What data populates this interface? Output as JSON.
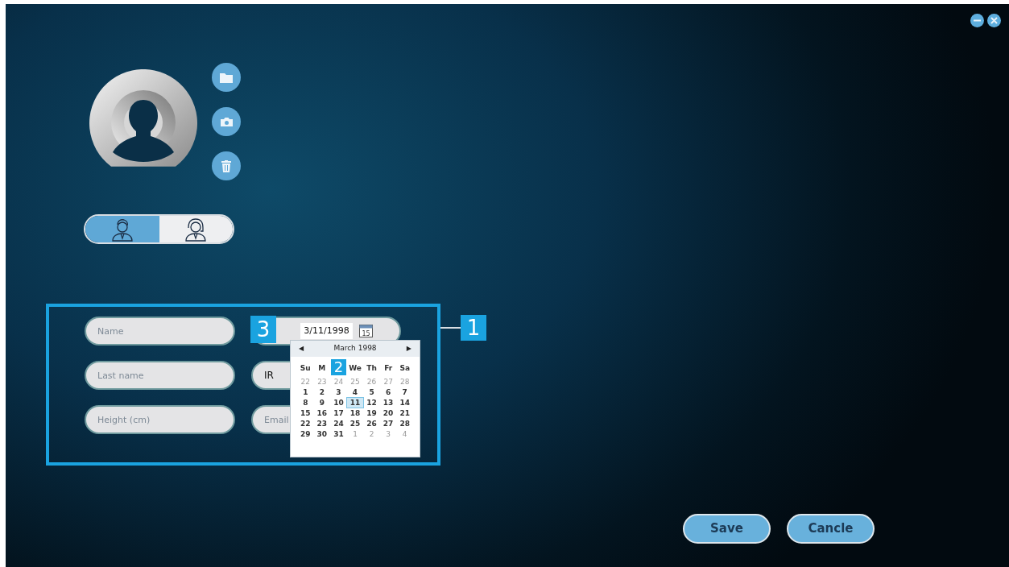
{
  "window": {
    "controls": [
      {
        "kind": "minimize"
      },
      {
        "kind": "close"
      }
    ]
  },
  "photo": {
    "actions": [
      {
        "kind": "folder"
      },
      {
        "kind": "camera"
      },
      {
        "kind": "delete"
      }
    ]
  },
  "gender": [
    {
      "kind": "male",
      "selected": true
    },
    {
      "kind": "female",
      "selected": false
    }
  ],
  "form": {
    "annotation": "1",
    "left_fields": [
      {
        "placeholder": "Name"
      },
      {
        "placeholder": "Last name"
      },
      {
        "placeholder": "Height (cm)"
      }
    ],
    "date_field": {
      "value": "3/11/1998",
      "icon_text": "15",
      "annotation": "3"
    },
    "region_field": {
      "value": "IR"
    },
    "email_field": {
      "placeholder": "Email"
    }
  },
  "calendar": {
    "title": "March 1998",
    "annotation": "2",
    "prev": "◀",
    "next": "▶",
    "weekdays": [
      "Su",
      "M",
      "We",
      "Th",
      "Fr",
      "Sa"
    ],
    "weeks": [
      [
        {
          "day": "22",
          "muted": true,
          "selected": false
        },
        {
          "day": "23",
          "muted": true,
          "selected": false
        },
        {
          "day": "24",
          "muted": true,
          "selected": false
        },
        {
          "day": "25",
          "muted": true,
          "selected": false
        },
        {
          "day": "26",
          "muted": true,
          "selected": false
        },
        {
          "day": "27",
          "muted": true,
          "selected": false
        },
        {
          "day": "28",
          "muted": true,
          "selected": false
        }
      ],
      [
        {
          "day": "1",
          "muted": false,
          "selected": false
        },
        {
          "day": "2",
          "muted": false,
          "selected": false
        },
        {
          "day": "3",
          "muted": false,
          "selected": false
        },
        {
          "day": "4",
          "muted": false,
          "selected": false
        },
        {
          "day": "5",
          "muted": false,
          "selected": false
        },
        {
          "day": "6",
          "muted": false,
          "selected": false
        },
        {
          "day": "7",
          "muted": false,
          "selected": false
        }
      ],
      [
        {
          "day": "8",
          "muted": false,
          "selected": false
        },
        {
          "day": "9",
          "muted": false,
          "selected": false
        },
        {
          "day": "10",
          "muted": false,
          "selected": false
        },
        {
          "day": "11",
          "muted": false,
          "selected": true
        },
        {
          "day": "12",
          "muted": false,
          "selected": false
        },
        {
          "day": "13",
          "muted": false,
          "selected": false
        },
        {
          "day": "14",
          "muted": false,
          "selected": false
        }
      ],
      [
        {
          "day": "15",
          "muted": false,
          "selected": false
        },
        {
          "day": "16",
          "muted": false,
          "selected": false
        },
        {
          "day": "17",
          "muted": false,
          "selected": false
        },
        {
          "day": "18",
          "muted": false,
          "selected": false
        },
        {
          "day": "19",
          "muted": false,
          "selected": false
        },
        {
          "day": "20",
          "muted": false,
          "selected": false
        },
        {
          "day": "21",
          "muted": false,
          "selected": false
        }
      ],
      [
        {
          "day": "22",
          "muted": false,
          "selected": false
        },
        {
          "day": "23",
          "muted": false,
          "selected": false
        },
        {
          "day": "24",
          "muted": false,
          "selected": false
        },
        {
          "day": "25",
          "muted": false,
          "selected": false
        },
        {
          "day": "26",
          "muted": false,
          "selected": false
        },
        {
          "day": "27",
          "muted": false,
          "selected": false
        },
        {
          "day": "28",
          "muted": false,
          "selected": false
        }
      ],
      [
        {
          "day": "29",
          "muted": false,
          "selected": false
        },
        {
          "day": "30",
          "muted": false,
          "selected": false
        },
        {
          "day": "31",
          "muted": false,
          "selected": false
        },
        {
          "day": "1",
          "muted": true,
          "selected": false
        },
        {
          "day": "2",
          "muted": true,
          "selected": false
        },
        {
          "day": "3",
          "muted": true,
          "selected": false
        },
        {
          "day": "4",
          "muted": true,
          "selected": false
        }
      ]
    ]
  },
  "buttons": [
    {
      "label": "Save"
    },
    {
      "label": "Cancle"
    }
  ]
}
